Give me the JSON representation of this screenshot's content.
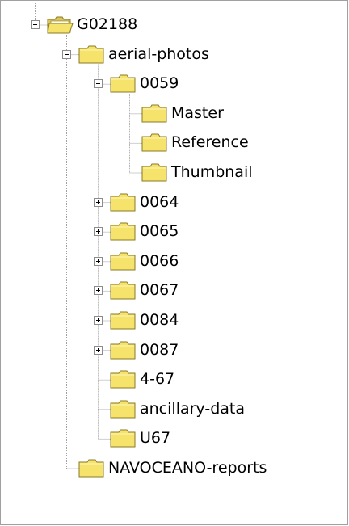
{
  "tree": {
    "nodes": [
      {
        "label": "G02188",
        "depth": 0,
        "toggle": "minus",
        "open_folder": true
      },
      {
        "label": "aerial-photos",
        "depth": 1,
        "toggle": "minus"
      },
      {
        "label": "0059",
        "depth": 2,
        "toggle": "minus"
      },
      {
        "label": "Master",
        "depth": 3,
        "toggle": "none"
      },
      {
        "label": "Reference",
        "depth": 3,
        "toggle": "none"
      },
      {
        "label": "Thumbnail",
        "depth": 3,
        "toggle": "none"
      },
      {
        "label": "0064",
        "depth": 2,
        "toggle": "plus"
      },
      {
        "label": "0065",
        "depth": 2,
        "toggle": "plus"
      },
      {
        "label": "0066",
        "depth": 2,
        "toggle": "plus"
      },
      {
        "label": "0067",
        "depth": 2,
        "toggle": "plus"
      },
      {
        "label": "0084",
        "depth": 2,
        "toggle": "plus"
      },
      {
        "label": "0087",
        "depth": 2,
        "toggle": "plus"
      },
      {
        "label": "4-67",
        "depth": 2,
        "toggle": "none"
      },
      {
        "label": "ancillary-data",
        "depth": 2,
        "toggle": "none"
      },
      {
        "label": "U67",
        "depth": 2,
        "toggle": "none"
      },
      {
        "label": "NAVOCEANO-reports",
        "depth": 1,
        "toggle": "none"
      }
    ]
  },
  "colors": {
    "folder_fill": "#f5e36c",
    "folder_edge": "#8a7a25",
    "guide_line": "#a0a0a0"
  }
}
